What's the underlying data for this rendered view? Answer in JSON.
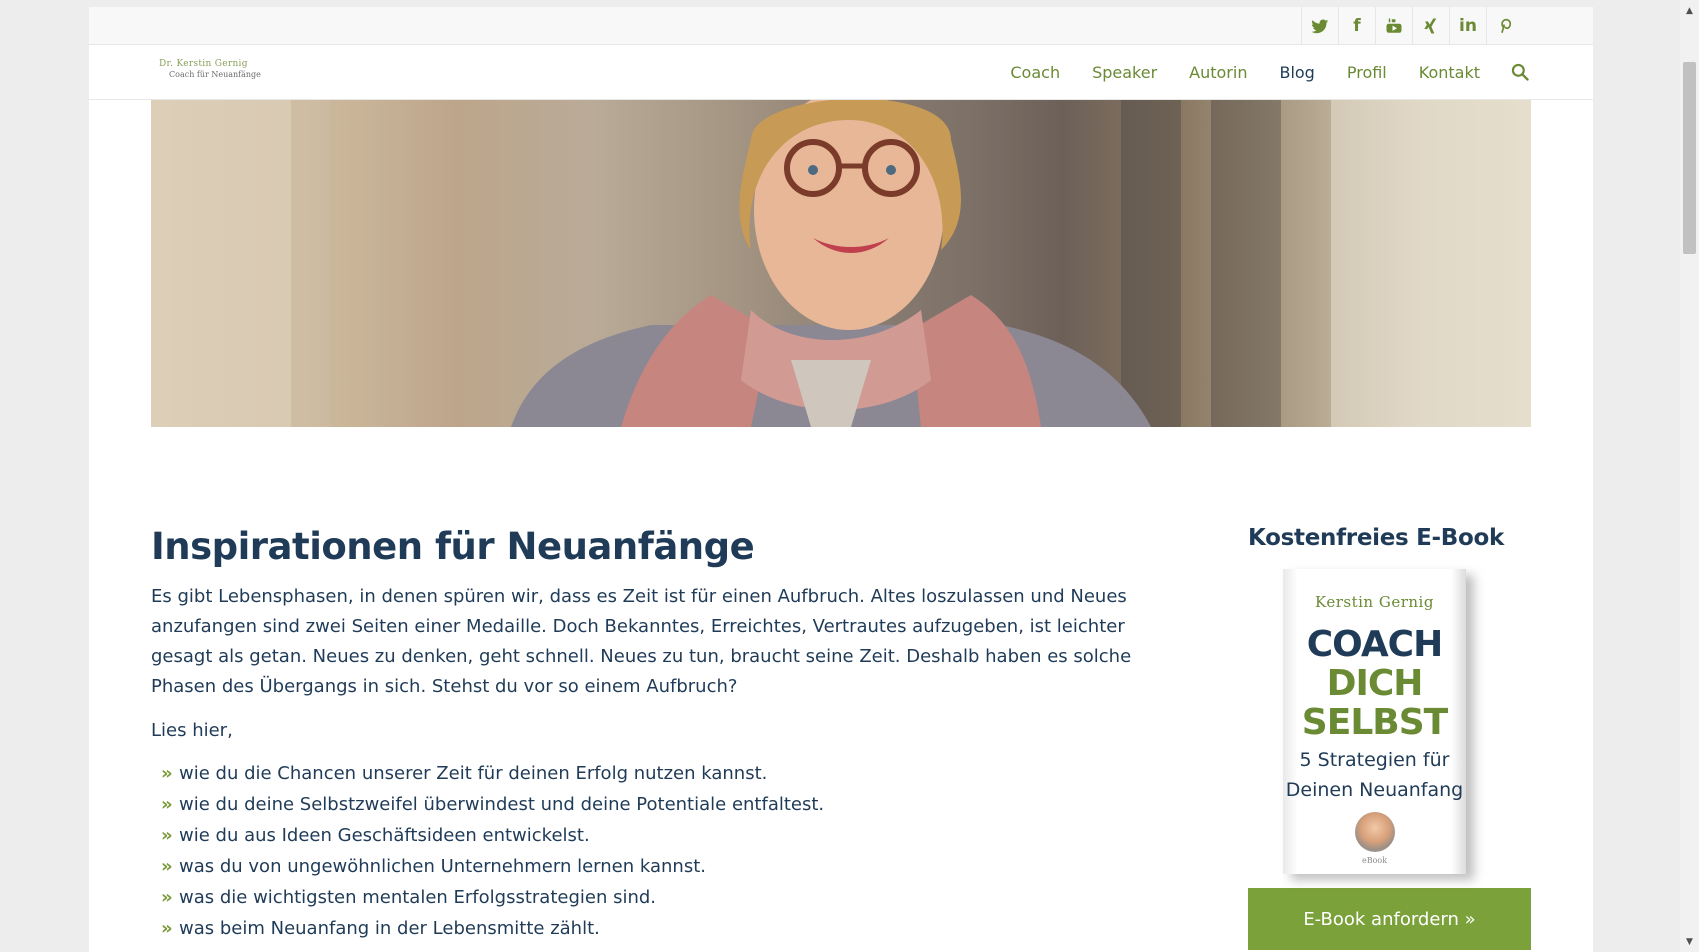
{
  "social": {
    "items": [
      {
        "icon": "twitter-icon",
        "label": ""
      },
      {
        "icon": "facebook-icon",
        "label": "f"
      },
      {
        "icon": "youtube-icon",
        "label": ""
      },
      {
        "icon": "xing-icon",
        "label": ""
      },
      {
        "icon": "linkedin-icon",
        "label": "in"
      },
      {
        "icon": "pinterest-icon",
        "label": ""
      }
    ]
  },
  "header": {
    "logo": {
      "name": "Dr. Kerstin Gernig",
      "tagline": "Coach für Neuanfänge"
    },
    "nav": [
      "Coach",
      "Speaker",
      "Autorin",
      "Blog",
      "Profil",
      "Kontakt"
    ],
    "active": "Blog",
    "search_icon": "search-icon"
  },
  "main": {
    "heading": "Inspirationen für Neuanfänge",
    "intro": "Es gibt Lebensphasen, in denen spüren wir, dass es Zeit ist für einen Aufbruch. Altes loszulassen und Neues anzufangen sind zwei Seiten einer Medaille. Doch Bekanntes, Erreichtes, Vertrautes aufzugeben, ist leichter gesagt als getan. Neues zu denken, geht schnell. Neues zu tun, braucht seine Zeit. Deshalb haben es solche Phasen des Übergangs in sich. Stehst du vor so einem Aufbruch?",
    "lead": "Lies hier,",
    "bullet_marker": "»",
    "bullets": [
      "wie du die Chancen unserer Zeit für deinen Erfolg nutzen kannst.",
      "wie du deine Selbstzweifel überwindest und deine Potentiale entfaltest.",
      "wie du aus Ideen Geschäftsideen entwickelst.",
      "was du von ungewöhnlichen Unternehmern lernen kannst.",
      "was die wichtigsten mentalen Erfolgsstrategien sind.",
      "was beim Neuanfang in der Lebensmitte zählt."
    ]
  },
  "sidebar": {
    "title": "Kostenfreies E-Book",
    "cover": {
      "author": "Kerstin Gernig",
      "title_line1": "COACH",
      "title_line2": "DICH",
      "title_line3": "SELBST",
      "subtitle_line1": "5 Strategien für",
      "subtitle_line2": "Deinen Neuanfang",
      "label": "eBook"
    },
    "button": "E-Book anfordern »"
  },
  "colors": {
    "accent_green": "#7ba13a",
    "nav_green": "#6a8a33",
    "navy": "#1f3b57"
  }
}
